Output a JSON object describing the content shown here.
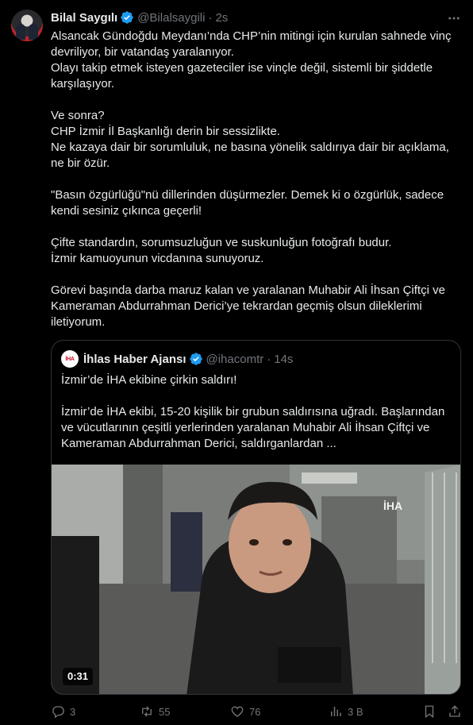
{
  "author": {
    "name": "Bilal Saygılı",
    "handle": "@Bilalsaygili",
    "separator": "·",
    "time": "2s"
  },
  "tweet": {
    "paragraphs": [
      [
        "Alsancak Gündoğdu Meydanı’nda CHP’nin mitingi için kurulan sahnede vinç devriliyor, bir vatandaş yaralanıyor.",
        "Olayı takip etmek isteyen gazeteciler ise vinçle değil, sistemli bir şiddetle karşılaşıyor."
      ],
      [
        "Ve sonra?",
        "CHP İzmir İl Başkanlığı derin bir sessizlikte.",
        "Ne kazaya dair bir sorumluluk, ne basına yönelik saldırıya dair bir açıklama, ne bir özür."
      ],
      [
        " \"Basın özgürlüğü\"nü dillerinden düşürmezler. Demek ki o özgürlük, sadece kendi sesiniz çıkınca geçerli!"
      ],
      [
        "Çifte standardın, sorumsuzluğun ve suskunluğun fotoğrafı budur.",
        "İzmir kamuoyunun vicdanına sunuyoruz."
      ],
      [
        "Görevi başında darba maruz kalan ve yaralanan Muhabir Ali İhsan Çiftçi ve Kameraman Abdurrahman Derici’ye tekrardan geçmiş olsun dileklerimi iletiyorum."
      ]
    ]
  },
  "quote": {
    "avatar_text": "İHA",
    "name": "İhlas Haber Ajansı",
    "handle": "@ihacomtr",
    "separator": "·",
    "time": "14s",
    "line1": "İzmir’de İHA ekibine çirkin saldırı!",
    "line2": "İzmir’de İHA ekibi, 15-20 kişilik bir grubun saldırısına uğradı. Başlarından ve vücutlarının çeşitli yerlerinden yaralanan Muhabir Ali İhsan Çiftçi ve Kameraman Abdurrahman Derici, saldırganlardan ...",
    "video_duration": "0:31",
    "watermark": "İHA"
  },
  "actions": {
    "replies": "3",
    "retweets": "55",
    "likes": "76",
    "views": "3 B"
  },
  "icons": {
    "verified": "verified-badge-icon",
    "more": "more-icon",
    "reply": "reply-icon",
    "retweet": "retweet-icon",
    "like": "heart-icon",
    "views": "views-icon",
    "bookmark": "bookmark-icon",
    "share": "share-icon"
  },
  "colors": {
    "background": "#000000",
    "text": "#e7e9ea",
    "secondary": "#71767b",
    "verified": "#1d9bf0",
    "border": "#2f3336"
  }
}
